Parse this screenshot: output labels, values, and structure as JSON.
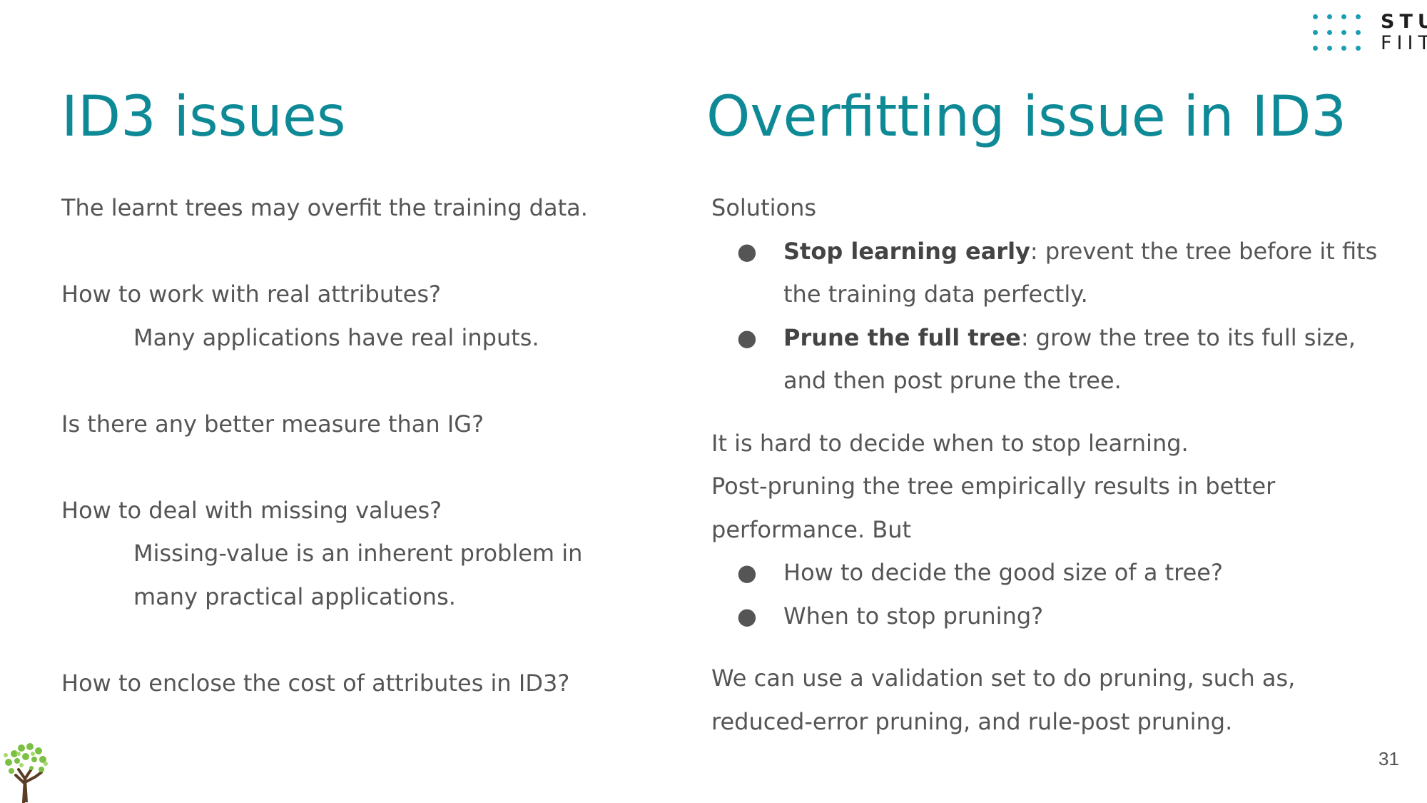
{
  "logo": {
    "line1": "STU",
    "line2": "FIIT"
  },
  "left": {
    "title": "ID3 issues",
    "lines": [
      "The learnt trees may overfit the training data.",
      "How to work with real attributes?",
      "Many applications have real inputs.",
      "Is there any better measure than IG?",
      "How to deal with missing values?",
      "Missing-value is an inherent problem in",
      "many practical applications.",
      "How to enclose the cost of attributes in ID3?"
    ]
  },
  "right": {
    "title": "Overfitting issue in ID3",
    "solutions_label": "Solutions",
    "solutions": [
      {
        "bold": "Stop learning early",
        "text": ": prevent the tree before it fits",
        "cont": "the training data perfectly."
      },
      {
        "bold": "Prune the full tree",
        "text": ": grow the tree to its full size,",
        "cont": "and then post prune the tree."
      }
    ],
    "para2": [
      "It is hard to decide when to stop learning.",
      "Post-pruning the tree empirically results in better",
      "performance. But"
    ],
    "questions": [
      "How to decide the good size of a tree?",
      "When to stop pruning?"
    ],
    "para3": [
      "We can use a validation set to do pruning, such as,",
      "reduced-error pruning, and rule-post pruning."
    ]
  },
  "bullet_char": "●",
  "page_number": "31",
  "colors": {
    "title": "#0e8a96",
    "body": "#555555",
    "logo_dots": "#1a9fb2"
  }
}
